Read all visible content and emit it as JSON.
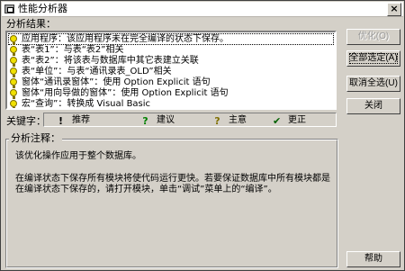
{
  "window": {
    "title": "性能分析器",
    "close_glyph": "×"
  },
  "results": {
    "label": "分析结果：",
    "items": [
      "应用程序：该应用程序未在完全编译的状态下保存。",
      "表“表1”：与表“表2”相关",
      "表“表2”：将该表与数据库中其它表建立关联",
      "表“单位”：与表“通讯录表_OLD”相关",
      "窗体“通讯录窗体”：使用 Option Explicit 语句",
      "窗体“用向导做的窗体”：使用 Option Explicit 语句",
      "宏“查询”：转换成 Visual Basic"
    ]
  },
  "buttons": {
    "optimize": "优化(O)",
    "select_all": "全部选定(A)",
    "deselect_all": "取消全选(U)",
    "close": "关闭",
    "help": "帮助"
  },
  "legend": {
    "label": "关键字：",
    "items": [
      {
        "icon": "!",
        "text": "推荐"
      },
      {
        "icon": "?",
        "text": "建议"
      },
      {
        "icon": "?",
        "text": "主意"
      },
      {
        "icon": "✔",
        "text": "更正"
      }
    ]
  },
  "notes": {
    "label": "分析注释：",
    "line1": "该优化操作应用于整个数据库。",
    "line2": "在编译状态下保存所有模块将使代码运行更快。若要保证数据库中所有模块都是在编译状态下保存的，请打开模块，单击“调试”菜单上的“编译”。"
  },
  "colors": {
    "bulb": "#f0e000",
    "check": "#006000"
  }
}
